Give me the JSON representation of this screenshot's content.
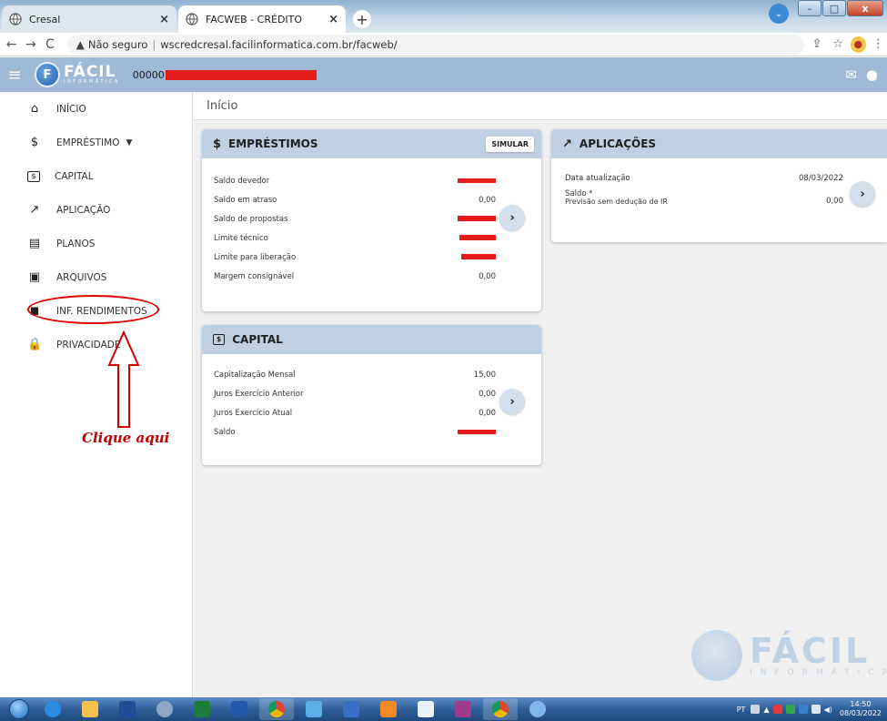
{
  "browser": {
    "tabs": [
      {
        "label": "Cresal",
        "active": false
      },
      {
        "label": "FACWEB - CRÉDITO",
        "active": true
      }
    ],
    "new_tab": "+",
    "security_label": "Não seguro",
    "url": "wscredcresal.facilinformatica.com.br/facweb/",
    "window_controls": {
      "minimize": "–",
      "maximize": "□",
      "close": "x"
    }
  },
  "app": {
    "logo_word": "FÁCIL",
    "logo_sub": "INFORMÁTICA",
    "user_code": "00000"
  },
  "sidebar": {
    "items": [
      {
        "label": "INÍCIO",
        "icon": "home-icon",
        "glyph": "⌂"
      },
      {
        "label": "EMPRÉSTIMO",
        "icon": "dollar-icon",
        "glyph": "$",
        "caret": "▼"
      },
      {
        "label": "CAPITAL",
        "icon": "capital-icon",
        "glyph": "$"
      },
      {
        "label": "APLICAÇÃO",
        "icon": "trending-up-icon",
        "glyph": "↗"
      },
      {
        "label": "PLANOS",
        "icon": "plans-icon",
        "glyph": "▤"
      },
      {
        "label": "ARQUIVOS",
        "icon": "archive-icon",
        "glyph": "▣"
      },
      {
        "label": "INF. RENDIMENTOS",
        "icon": "wallet-icon",
        "glyph": "◼"
      },
      {
        "label": "PRIVACIDADE",
        "icon": "lock-icon",
        "glyph": "🔒"
      }
    ]
  },
  "annotation": {
    "text": "Clique aqui",
    "color": "#c40000"
  },
  "page": {
    "title": "Início"
  },
  "emprestimos": {
    "title": "EMPRÉSTIMOS",
    "action": "SIMULAR",
    "rows": [
      {
        "label": "Saldo devedor",
        "value": null
      },
      {
        "label": "Saldo em atraso",
        "value": "0,00"
      },
      {
        "label": "Saldo de propostas",
        "value": null
      },
      {
        "label": "Limite técnico",
        "value": null
      },
      {
        "label": "Limite para liberação",
        "value": null
      },
      {
        "label": "Margem consignável",
        "value": "0,00"
      }
    ]
  },
  "capital": {
    "title": "CAPITAL",
    "rows": [
      {
        "label": "Capitalização Mensal",
        "value": "15,00"
      },
      {
        "label": "Juros Exercício Anterior",
        "value": "0,00"
      },
      {
        "label": "Juros Exercício Atual",
        "value": "0,00"
      },
      {
        "label": "Saldo",
        "value": null
      }
    ]
  },
  "aplicacoes": {
    "title": "APLICAÇÕES",
    "update_label": "Data atualização",
    "update_value": "08/03/2022",
    "saldo_label": "Saldo *",
    "saldo_value": "0,00",
    "note": "Previsão sem dedução de IR"
  },
  "go_glyph": "›",
  "watermark": {
    "word": "FÁCIL",
    "sub": "INFORMÁTICA"
  },
  "taskbar": {
    "lang": "PT",
    "time": "14:50",
    "date": "08/03/2022"
  },
  "colors": {
    "header_blue": "#9fb9d6",
    "card_head": "#c0d0e3",
    "redaction": "#e41c1c"
  }
}
